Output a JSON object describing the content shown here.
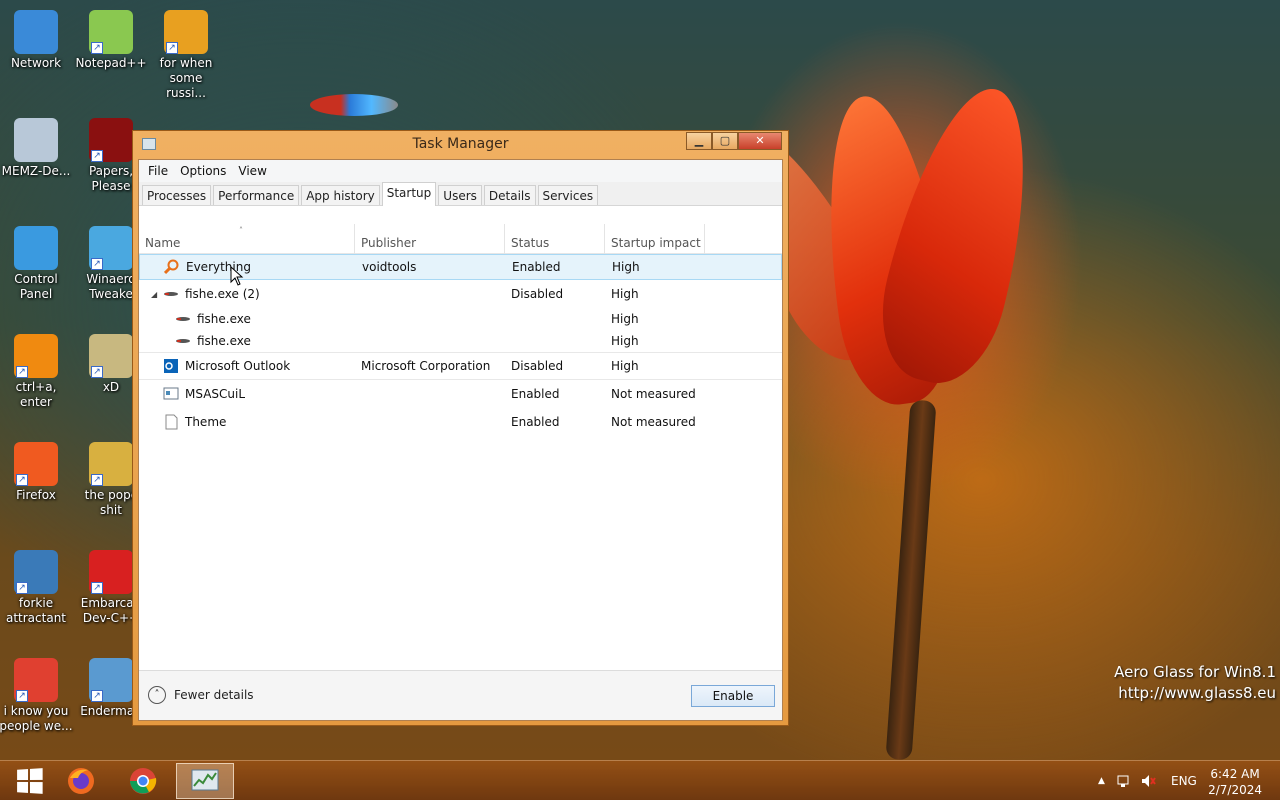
{
  "desktop": {
    "icons": [
      {
        "label": "Network",
        "color": "#3a8ad8"
      },
      {
        "label": "Notepad++",
        "color": "#8ac850"
      },
      {
        "label": "for when some russi...",
        "color": "#e8a020"
      },
      {
        "label": "MEMZ-De...",
        "color": "#b8c8d8"
      },
      {
        "label": "Papers, Please",
        "color": "#8a1010"
      },
      {
        "label": "Control Panel",
        "color": "#3a9ae0"
      },
      {
        "label": "Winaero Tweake",
        "color": "#4aa8e0"
      },
      {
        "label": "ctrl+a, enter",
        "color": "#f08a10"
      },
      {
        "label": "xD",
        "color": "#c8b880"
      },
      {
        "label": "Firefox",
        "color": "#f05a20"
      },
      {
        "label": "the popc shit",
        "color": "#d8b040"
      },
      {
        "label": "forkie attractant",
        "color": "#3a7ab8"
      },
      {
        "label": "Embarcad Dev-C++",
        "color": "#d82020"
      },
      {
        "label": "i know you people we...",
        "color": "#e04030"
      },
      {
        "label": "Enderman",
        "color": "#5a9ad0"
      }
    ]
  },
  "watermark": {
    "line1": "Aero Glass for Win8.1",
    "line2": "http://www.glass8.eu"
  },
  "window": {
    "title": "Task Manager",
    "controls": {
      "minimize": "▁",
      "maximize": "▢",
      "close": "✕"
    },
    "menu": [
      "File",
      "Options",
      "View"
    ],
    "tabs": [
      "Processes",
      "Performance",
      "App history",
      "Startup",
      "Users",
      "Details",
      "Services"
    ],
    "active_tab": "Startup",
    "columns": [
      "Name",
      "Publisher",
      "Status",
      "Startup impact"
    ],
    "sort_indicator": "˄",
    "rows": [
      {
        "name": "Everything",
        "publisher": "voidtools",
        "status": "Enabled",
        "impact": "High",
        "icon": "magnifier-icon"
      },
      {
        "name": "fishe.exe (2)",
        "publisher": "",
        "status": "Disabled",
        "impact": "High",
        "icon": "fish-icon",
        "expander": "◢"
      },
      {
        "name": "fishe.exe",
        "publisher": "",
        "status": "",
        "impact": "High",
        "icon": "fish-icon"
      },
      {
        "name": "fishe.exe",
        "publisher": "",
        "status": "",
        "impact": "High",
        "icon": "fish-icon"
      },
      {
        "name": "Microsoft Outlook",
        "publisher": "Microsoft Corporation",
        "status": "Disabled",
        "impact": "High",
        "icon": "outlook-icon"
      },
      {
        "name": "MSASCuiL",
        "publisher": "",
        "status": "Enabled",
        "impact": "Not measured",
        "icon": "defender-icon"
      },
      {
        "name": "Theme",
        "publisher": "",
        "status": "Enabled",
        "impact": "Not measured",
        "icon": "file-icon"
      }
    ],
    "fewer_details": "Fewer details",
    "fewer_glyph": "˄",
    "enable_button": "Enable"
  },
  "taskbar": {
    "tray_arrow": "▲",
    "language": "ENG",
    "time": "6:42 AM",
    "date": "2/7/2024"
  }
}
